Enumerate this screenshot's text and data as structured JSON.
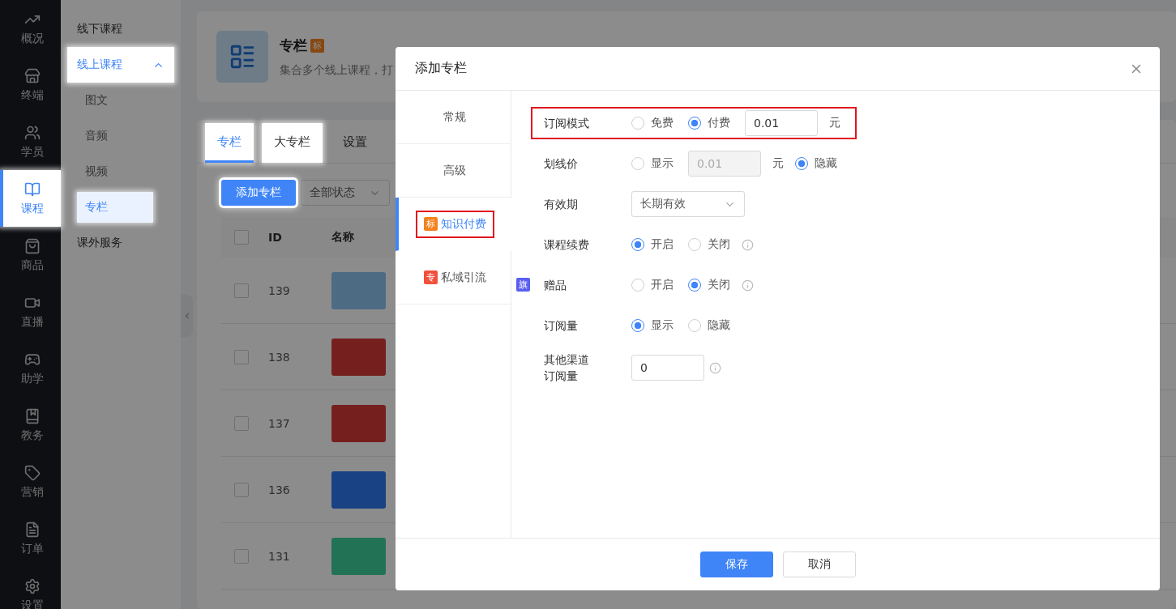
{
  "nav": {
    "items": [
      {
        "label": "概况",
        "selected": false,
        "spotlight": false
      },
      {
        "label": "终端",
        "selected": false,
        "spotlight": false
      },
      {
        "label": "学员",
        "selected": false,
        "spotlight": false
      },
      {
        "label": "课程",
        "selected": true,
        "spotlight": true
      },
      {
        "label": "商品",
        "selected": false,
        "spotlight": false
      },
      {
        "label": "直播",
        "selected": false,
        "spotlight": false
      },
      {
        "label": "助学",
        "selected": false,
        "spotlight": false
      },
      {
        "label": "教务",
        "selected": false,
        "spotlight": false
      },
      {
        "label": "营销",
        "selected": false,
        "spotlight": false
      },
      {
        "label": "订单",
        "selected": false,
        "spotlight": false
      },
      {
        "label": "设置",
        "selected": false,
        "spotlight": false
      }
    ]
  },
  "subnav": {
    "items": [
      {
        "label": "线下课程",
        "selected": false,
        "spotlight": false
      },
      {
        "label": "线上课程",
        "selected": true,
        "spotlight": true,
        "expanded": true,
        "children": [
          {
            "label": "图文",
            "selected": false,
            "spotlight": false
          },
          {
            "label": "音频",
            "selected": false,
            "spotlight": false
          },
          {
            "label": "视频",
            "selected": false,
            "spotlight": false
          },
          {
            "label": "专栏",
            "selected": true,
            "spotlight": true
          }
        ]
      },
      {
        "label": "课外服务",
        "selected": false,
        "spotlight": false
      }
    ]
  },
  "header_card": {
    "title": "专栏",
    "badge": "标",
    "subtitle": "集合多个线上课程，打"
  },
  "tabs": [
    {
      "label": "专栏",
      "selected": true,
      "spotlight": true
    },
    {
      "label": "大专栏",
      "selected": false,
      "spotlight": true
    },
    {
      "label": "设置",
      "selected": false,
      "spotlight": false
    }
  ],
  "toolbar": {
    "add_button": {
      "label": "添加专栏",
      "spotlight": true
    },
    "status_select": "全部状态"
  },
  "table": {
    "header_checked": false,
    "columns": [
      "ID",
      "名称"
    ],
    "rows": [
      {
        "id": "139",
        "checked": false
      },
      {
        "id": "138",
        "checked": false
      },
      {
        "id": "137",
        "checked": false
      },
      {
        "id": "136",
        "checked": false
      },
      {
        "id": "131",
        "checked": false
      }
    ]
  },
  "modal": {
    "title": "添加专栏",
    "side_tabs": [
      {
        "label": "常规",
        "selected": false,
        "highlighted": false
      },
      {
        "label": "高级",
        "selected": false,
        "highlighted": false
      },
      {
        "label": "知识付费",
        "badge": {
          "text": "标",
          "color": "#f5821f"
        },
        "selected": true,
        "highlighted": true
      },
      {
        "label": "私域引流",
        "badge": {
          "text": "专",
          "color": "#f0503c"
        },
        "selected": false,
        "highlighted": false
      }
    ],
    "rows": [
      {
        "label": "订阅模式",
        "highlighted": true,
        "controls": [
          {
            "kind": "radio",
            "label": "免费",
            "selected": false
          },
          {
            "kind": "radio",
            "label": "付费",
            "selected": true
          },
          {
            "kind": "input",
            "value": "0.01",
            "disabled": false
          },
          {
            "kind": "unit",
            "text": "元"
          }
        ]
      },
      {
        "label": "划线价",
        "highlighted": false,
        "controls": [
          {
            "kind": "radio",
            "label": "显示",
            "selected": false
          },
          {
            "kind": "input",
            "value": "0.01",
            "disabled": true
          },
          {
            "kind": "unit",
            "text": "元"
          },
          {
            "kind": "radio",
            "label": "隐藏",
            "selected": true
          }
        ]
      },
      {
        "label": "有效期",
        "highlighted": false,
        "controls": [
          {
            "kind": "select",
            "value": "长期有效"
          }
        ]
      },
      {
        "label": "课程续费",
        "highlighted": false,
        "controls": [
          {
            "kind": "radio",
            "label": "开启",
            "selected": true
          },
          {
            "kind": "radio",
            "label": "关闭",
            "selected": false
          },
          {
            "kind": "info"
          }
        ]
      },
      {
        "label": "赠品",
        "badge": {
          "text": "旗",
          "color": "#5b5ff0"
        },
        "highlighted": false,
        "controls": [
          {
            "kind": "radio",
            "label": "开启",
            "selected": false
          },
          {
            "kind": "radio",
            "label": "关闭",
            "selected": true
          },
          {
            "kind": "info"
          }
        ]
      },
      {
        "label": "订阅量",
        "highlighted": false,
        "controls": [
          {
            "kind": "radio",
            "label": "显示",
            "selected": true
          },
          {
            "kind": "radio",
            "label": "隐藏",
            "selected": false
          }
        ]
      },
      {
        "label": "其他渠道订阅量",
        "highlighted": false,
        "controls": [
          {
            "kind": "input",
            "value": "0",
            "disabled": false
          },
          {
            "kind": "info"
          }
        ]
      }
    ],
    "buttons": [
      {
        "label": "保存",
        "kind": "primary"
      },
      {
        "label": "取消",
        "kind": "default"
      }
    ]
  }
}
